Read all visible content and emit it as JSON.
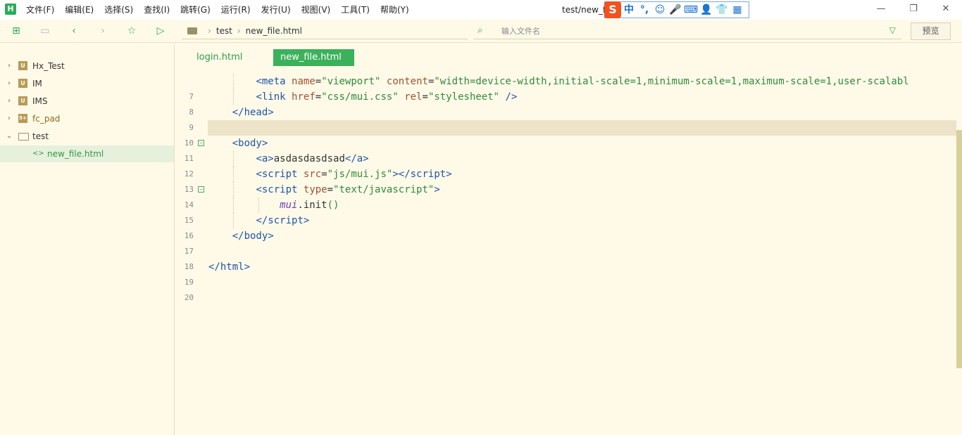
{
  "app": {
    "logo_letter": "H",
    "window_title": "test/new_fi"
  },
  "menu": [
    "文件(F)",
    "编辑(E)",
    "选择(S)",
    "查找(I)",
    "跳转(G)",
    "运行(R)",
    "发行(U)",
    "视图(V)",
    "工具(T)",
    "帮助(Y)"
  ],
  "ime": {
    "logo": "S",
    "items": [
      "中",
      "°,",
      "☺",
      "🎤",
      "⌨",
      "👤",
      "👕",
      "▦"
    ]
  },
  "toolbar": {
    "breadcrumb": [
      "test",
      "new_file.html"
    ],
    "search_placeholder": "输入文件名",
    "preview_label": "预览"
  },
  "sidebar": {
    "items": [
      {
        "label": "Hx_Test",
        "icon": "U",
        "expanded": false
      },
      {
        "label": "IM",
        "icon": "U",
        "expanded": false
      },
      {
        "label": "IMS",
        "icon": "U",
        "expanded": false
      },
      {
        "label": "fc_pad",
        "icon": "5+",
        "expanded": false
      },
      {
        "label": "test",
        "icon": "folder",
        "expanded": true
      },
      {
        "label": "new_file.html",
        "icon": "<>",
        "selected": true
      }
    ]
  },
  "tabs": [
    {
      "label": "login.html",
      "active": false
    },
    {
      "label": "new_file.html",
      "active": true
    }
  ],
  "editor": {
    "line_numbers": [
      "7",
      "8",
      "9",
      "10",
      "11",
      "12",
      "13",
      "14",
      "15",
      "16",
      "17",
      "18",
      "19",
      "20"
    ],
    "highlighted_line": "10"
  },
  "colors": {
    "accent": "#3cb15c",
    "background": "#fffae8",
    "tag": "#1e54a8",
    "string": "#2f8a3a"
  }
}
